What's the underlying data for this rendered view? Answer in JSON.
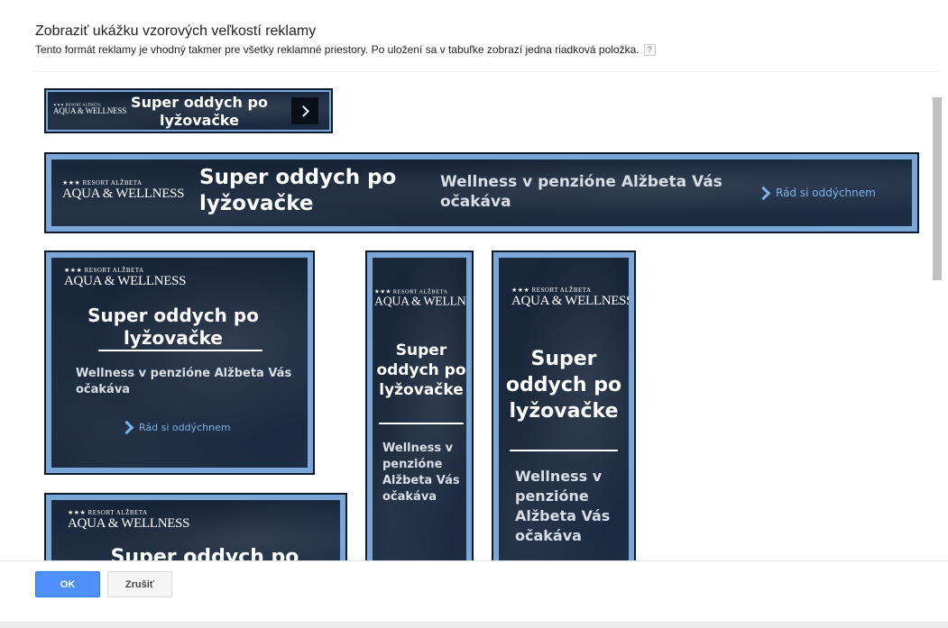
{
  "dialog": {
    "title": "Zobraziť ukážku vzorových veľkostí reklamy",
    "description": "Tento formát reklamy je vhodný takmer pre všetky reklamné priestory. Po uložení sa v tabuľke zobrazí jedna riadková položka.",
    "help_icon": "?"
  },
  "ad": {
    "logo_small": "★★★ RESORT ALŽBETA",
    "logo_big": "AQUA & WELLNESS",
    "headline": "Super oddych po lyžovačke",
    "description": "Wellness v penzióne Alžbeta Vás očakáva",
    "cta": "Rád si oddýchnem",
    "colors": {
      "frame": "#7aa6d8",
      "background": "#1a2a40",
      "cta": "#7fb2ea"
    }
  },
  "buttons": {
    "ok": "OK",
    "cancel": "Zrušiť"
  }
}
